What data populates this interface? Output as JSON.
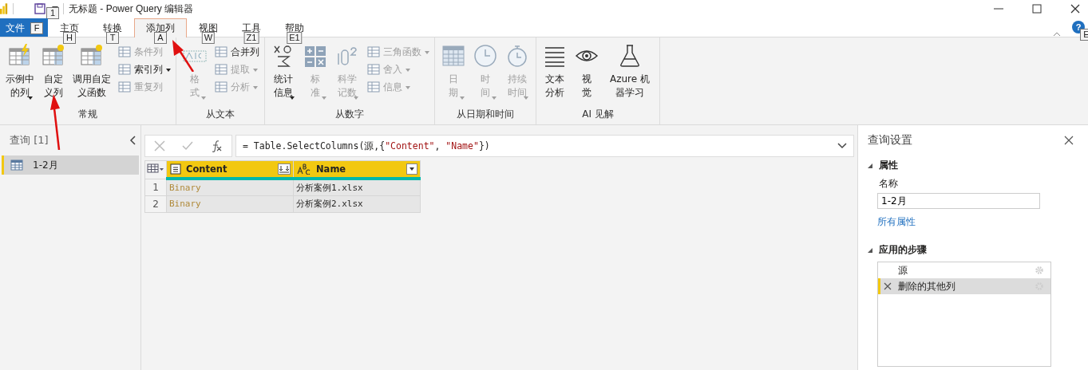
{
  "window": {
    "title": "无标题 - Power Query 编辑器",
    "save_keytip": "1",
    "help_label": "?",
    "help_keytip": "E"
  },
  "tabs": [
    {
      "label": "文件",
      "keytip": "F",
      "kind": "file",
      "selected": false
    },
    {
      "label": "主页",
      "keytip": "H",
      "kind": "tab",
      "selected": false
    },
    {
      "label": "转换",
      "keytip": "T",
      "kind": "tab",
      "selected": false
    },
    {
      "label": "添加列",
      "keytip": "A",
      "kind": "tab",
      "selected": true
    },
    {
      "label": "视图",
      "keytip": "W",
      "kind": "tab",
      "selected": false
    },
    {
      "label": "工具",
      "keytip": "Z1",
      "kind": "tab",
      "selected": false
    },
    {
      "label": "帮助",
      "keytip": "E1",
      "kind": "tab",
      "selected": false
    }
  ],
  "ribbon_groups": [
    {
      "label": "常规",
      "large": [
        {
          "label": "示例中的列",
          "dropdown": true,
          "disabled": false
        },
        {
          "label": "自定义列",
          "dropdown": false,
          "disabled": false
        },
        {
          "label": "调用自定义函数",
          "dropdown": false,
          "disabled": false
        }
      ],
      "small": [
        {
          "label": "条件列",
          "dropdown": false,
          "disabled": true
        },
        {
          "label": "索引列",
          "dropdown": true,
          "disabled": false
        },
        {
          "label": "重复列",
          "dropdown": false,
          "disabled": true
        }
      ]
    },
    {
      "label": "从文本",
      "large": [
        {
          "label": "格式",
          "dropdown": true,
          "disabled": true
        }
      ],
      "small": [
        {
          "label": "合并列",
          "dropdown": false,
          "disabled": false
        },
        {
          "label": "提取",
          "dropdown": true,
          "disabled": true
        },
        {
          "label": "分析",
          "dropdown": true,
          "disabled": true
        }
      ]
    },
    {
      "label": "从数字",
      "large": [
        {
          "label": "统计信息",
          "dropdown": true,
          "disabled": false
        },
        {
          "label": "标准",
          "dropdown": true,
          "disabled": true
        },
        {
          "label": "科学记数",
          "dropdown": true,
          "disabled": true
        }
      ],
      "small": [
        {
          "label": "三角函数",
          "dropdown": true,
          "disabled": true
        },
        {
          "label": "舍入",
          "dropdown": true,
          "disabled": true
        },
        {
          "label": "信息",
          "dropdown": true,
          "disabled": true
        }
      ]
    },
    {
      "label": "从日期和时间",
      "large": [
        {
          "label": "日期",
          "dropdown": true,
          "disabled": true
        },
        {
          "label": "时间",
          "dropdown": true,
          "disabled": true
        },
        {
          "label": "持续时间",
          "dropdown": true,
          "disabled": true
        }
      ]
    },
    {
      "label": "AI 见解",
      "large": [
        {
          "label": "文本分析",
          "dropdown": false,
          "disabled": false
        },
        {
          "label": "视觉",
          "dropdown": false,
          "disabled": false
        },
        {
          "label": "Azure 机器学习",
          "dropdown": false,
          "disabled": false
        }
      ]
    }
  ],
  "queries": {
    "title": "查询 [1]",
    "items": [
      {
        "label": "1-2月",
        "selected": true
      }
    ]
  },
  "formula": {
    "tokens": [
      {
        "text": "= Table.SelectColumns(源,{",
        "kind": "code"
      },
      {
        "text": "\"Content\"",
        "kind": "string"
      },
      {
        "text": ", ",
        "kind": "code"
      },
      {
        "text": "\"Name\"",
        "kind": "string"
      },
      {
        "text": "})",
        "kind": "code"
      }
    ]
  },
  "table": {
    "columns": [
      {
        "name": "Content",
        "kind": "binary"
      },
      {
        "name": "Name",
        "kind": "text"
      }
    ],
    "rows": [
      {
        "number": "1",
        "cells": [
          "Binary",
          "分析案例1.xlsx"
        ]
      },
      {
        "number": "2",
        "cells": [
          "Binary",
          "分析案例2.xlsx"
        ]
      }
    ]
  },
  "settings": {
    "title": "查询设置",
    "properties_heading": "属性",
    "name_label": "名称",
    "name_value": "1-2月",
    "all_properties": "所有属性",
    "steps_heading": "应用的步骤",
    "steps": [
      {
        "label": "源",
        "deletable": false,
        "selected": false
      },
      {
        "label": "删除的其他列",
        "deletable": true,
        "selected": true
      }
    ]
  }
}
